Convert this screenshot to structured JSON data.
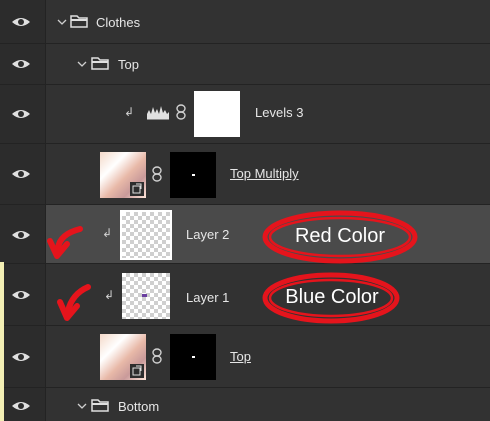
{
  "layers_panel": {
    "rows": [
      {
        "label": "Clothes"
      },
      {
        "label": "Top"
      },
      {
        "label": "Levels 3"
      },
      {
        "label": "Top Multiply"
      },
      {
        "label": "Layer 2"
      },
      {
        "label": "Layer 1"
      },
      {
        "label": "Top"
      },
      {
        "label": "Bottom"
      }
    ]
  },
  "annotations": {
    "red_label": "Red Color",
    "blue_label": "Blue Color",
    "color": "#e5141c"
  },
  "colors": {
    "panel_bg": "#323232",
    "eye_col_bg": "#2c2c2c",
    "selected_row_bg": "#4a4a4a"
  }
}
